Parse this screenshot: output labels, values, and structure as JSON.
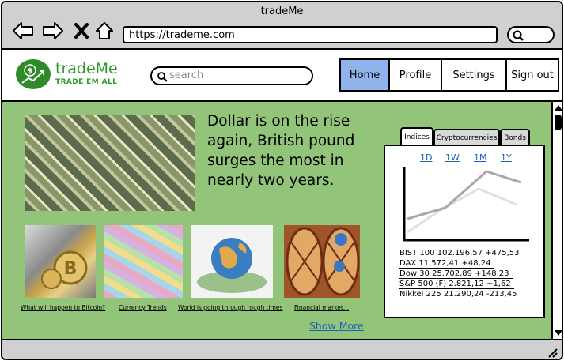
{
  "window": {
    "title": "tradeMe"
  },
  "browser": {
    "url": "https://trademe.com"
  },
  "site": {
    "name": "tradeMe",
    "tagline": "TRADE EM ALL",
    "search_placeholder": "search"
  },
  "nav": [
    {
      "label": "Home",
      "active": true
    },
    {
      "label": "Profile",
      "active": false
    },
    {
      "label": "Settings",
      "active": false
    },
    {
      "label": "Sign out",
      "active": false
    }
  ],
  "hero": {
    "headline": "Dollar is on the rise again, British pound surges the most in nearly two years."
  },
  "articles": [
    {
      "caption": "What will happen to Bitcoin?"
    },
    {
      "caption": "Currency Trends"
    },
    {
      "caption": "World is going through rough times"
    },
    {
      "caption": "Financial market..."
    }
  ],
  "show_more": "Show More",
  "market": {
    "tabs": [
      "Indices",
      "Cryptocurrencies",
      "Bonds"
    ],
    "active_tab": "Indices",
    "periods": [
      "1D",
      "1W",
      "1M",
      "1Y"
    ],
    "indices": [
      {
        "text": "BIST 100 102.196,57 +475,53"
      },
      {
        "text": "DAX 11.572,41 +48,24"
      },
      {
        "text": "Dow 30 25.702,89 +148,23"
      },
      {
        "text": "S&P 500 (F) 2.821,12 +1,62"
      },
      {
        "text": "Nikkei 225 21.290,24 -213,45"
      }
    ]
  },
  "colors": {
    "content_bg": "#92c57a",
    "brand_green": "#2e9a2a",
    "nav_active": "#8fb3ea",
    "link_blue": "#1d5fb8"
  }
}
